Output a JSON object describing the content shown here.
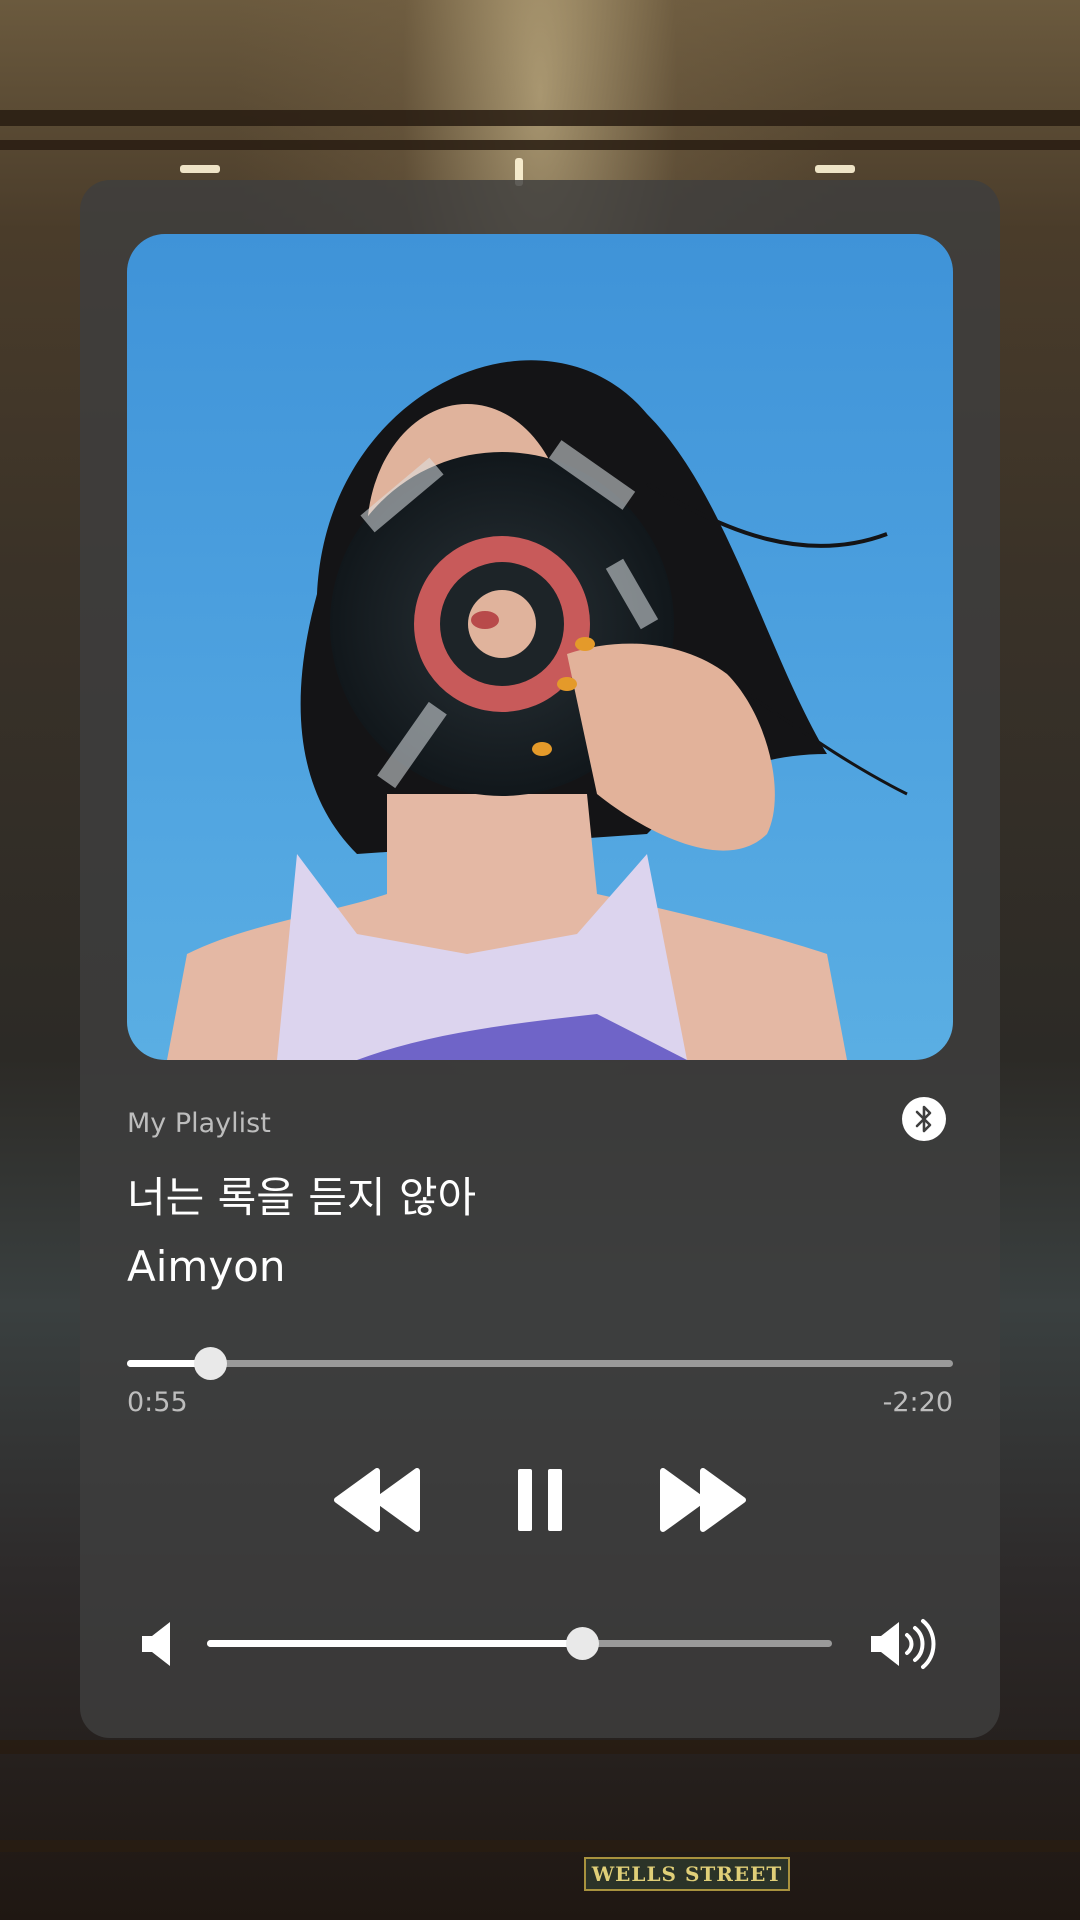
{
  "player": {
    "playlist_label": "My Playlist",
    "song_title": "너는 록을 듣지 않아",
    "artist": "Aimyon",
    "time_elapsed": "0:55",
    "time_remaining": "-2:20",
    "progress_fraction": 0.1,
    "volume_fraction": 0.6
  },
  "icons": {
    "bluetooth": "bluetooth-icon",
    "rewind": "rewind-icon",
    "pause": "pause-icon",
    "fast_forward": "fast-forward-icon",
    "volume_low": "volume-low-icon",
    "volume_high": "volume-high-icon"
  },
  "background": {
    "sign_text": "WELLS STREET"
  },
  "colors": {
    "card": "#3e3e3e",
    "text_primary": "#ffffff",
    "text_secondary": "#bdbdbd",
    "track": "#9a9a9a",
    "sky": "#4fa3e0"
  }
}
